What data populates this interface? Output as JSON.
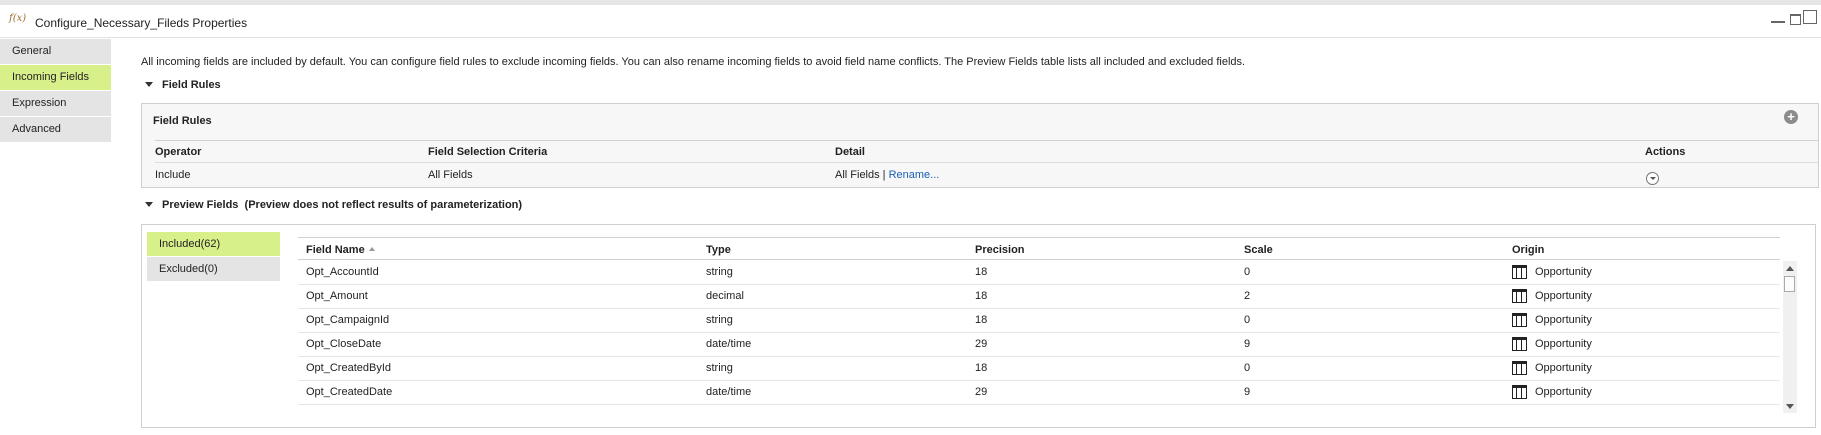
{
  "window": {
    "title": "Configure_Necessary_Fileds Properties",
    "app_icon": "fx-icon",
    "grip": "\"\"\"\""
  },
  "nav": {
    "items": [
      {
        "label": "General",
        "active": false
      },
      {
        "label": "Incoming Fields",
        "active": true
      },
      {
        "label": "Expression",
        "active": false
      },
      {
        "label": "Advanced",
        "active": false
      }
    ]
  },
  "description": "All incoming fields are included by default. You can configure field rules to exclude incoming fields. You can also rename incoming fields to avoid field name conflicts. The Preview Fields table lists all included and excluded fields.",
  "field_rules": {
    "section_title": "Field Rules",
    "panel_title": "Field Rules",
    "add_icon": "plus-circle-icon",
    "columns": [
      "Operator",
      "Field Selection Criteria",
      "Detail",
      "Actions"
    ],
    "rows": [
      {
        "operator": "Include",
        "criteria": "All Fields",
        "detail": "All Fields | ",
        "detail_link": "Rename...",
        "action_icon": "chevron-down-circle-icon"
      }
    ]
  },
  "preview_fields": {
    "section_title": "Preview Fields  (Preview does not reflect results of parameterization)",
    "tabs": [
      {
        "label": "Included(62)",
        "active": true
      },
      {
        "label": "Excluded(0)",
        "active": false
      }
    ],
    "columns": [
      "Field Name",
      "Type",
      "Precision",
      "Scale",
      "Origin"
    ],
    "sort_column": "Field Name",
    "sort_direction": "ascending",
    "rows": [
      {
        "name": "Opt_AccountId",
        "type": "string",
        "precision": "18",
        "scale": "0",
        "origin": "Opportunity"
      },
      {
        "name": "Opt_Amount",
        "type": "decimal",
        "precision": "18",
        "scale": "2",
        "origin": "Opportunity"
      },
      {
        "name": "Opt_CampaignId",
        "type": "string",
        "precision": "18",
        "scale": "0",
        "origin": "Opportunity"
      },
      {
        "name": "Opt_CloseDate",
        "type": "date/time",
        "precision": "29",
        "scale": "9",
        "origin": "Opportunity"
      },
      {
        "name": "Opt_CreatedById",
        "type": "string",
        "precision": "18",
        "scale": "0",
        "origin": "Opportunity"
      },
      {
        "name": "Opt_CreatedDate",
        "type": "date/time",
        "precision": "29",
        "scale": "9",
        "origin": "Opportunity"
      }
    ],
    "origin_icon": "table-icon"
  },
  "colors": {
    "active_highlight": "#d8f08a",
    "tab_inactive": "#e4e4e4",
    "link": "#1a5fb4"
  }
}
